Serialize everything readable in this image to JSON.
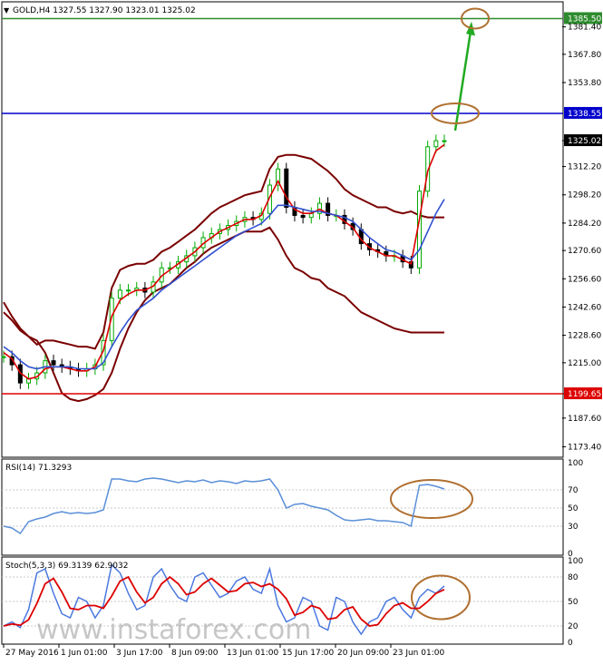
{
  "chart_data": {
    "type": "line",
    "instrument_header": "GOLD,H4  1327.55 1327.90 1323.01 1325.02",
    "watermark": "www.instaforex.com",
    "x_ticks": [
      "27 May 2016",
      "1 Jun 01:00",
      "3 Jun 17:00",
      "8 Jun 09:00",
      "13 Jun 01:00",
      "15 Jun 17:00",
      "20 Jun 09:00",
      "23 Jun 01:00"
    ],
    "price_panel": {
      "ylim": [
        1170.0,
        1392.0
      ],
      "y_ticks": [
        "1381.40",
        "1367.80",
        "1353.80",
        "1325.02",
        "1312.20",
        "1298.20",
        "1284.20",
        "1270.60",
        "1256.60",
        "1242.60",
        "1228.60",
        "1215.00",
        "1199.65",
        "1187.60",
        "1173.40"
      ],
      "levels": [
        {
          "label": "1385.50",
          "value": 1385.5,
          "color": "#2e8b2e"
        },
        {
          "label": "1338.55",
          "value": 1338.55,
          "color": "#0000cc"
        },
        {
          "label": "1199.65",
          "value": 1199.65,
          "color": "#dd0000"
        }
      ],
      "current_price_label": "1325.02",
      "current_price": 1325.02,
      "series": [
        {
          "values": [
            1218,
            1214,
            1205,
            1207,
            1210,
            1216,
            1214,
            1213,
            1212,
            1211,
            1212,
            1214,
            1226,
            1247,
            1251,
            1251,
            1252,
            1250,
            1255,
            1262,
            1262,
            1265,
            1268,
            1272,
            1277,
            1279,
            1281,
            1283,
            1285,
            1287,
            1286,
            1289,
            1303,
            1311,
            1292,
            1288,
            1287,
            1289,
            1294,
            1288,
            1288,
            1284,
            1281,
            1274,
            1271,
            1270,
            1268,
            1268,
            1265,
            1262,
            1300,
            1322,
            1325,
            1325
          ]
        }
      ],
      "moving_averages": [
        {
          "color": "#dd0000",
          "values": [
            1220,
            1217,
            1210,
            1207,
            1208,
            1212,
            1213,
            1213,
            1212,
            1211,
            1211,
            1213,
            1221,
            1238,
            1246,
            1249,
            1251,
            1251,
            1253,
            1258,
            1261,
            1264,
            1267,
            1270,
            1274,
            1277,
            1280,
            1282,
            1284,
            1286,
            1286,
            1288,
            1297,
            1305,
            1297,
            1291,
            1289,
            1289,
            1291,
            1289,
            1288,
            1285,
            1282,
            1276,
            1272,
            1270,
            1268,
            1268,
            1266,
            1264,
            1286,
            1310,
            1320,
            1323
          ]
        },
        {
          "color": "#3050d0",
          "values": [
            1223,
            1220,
            1216,
            1213,
            1212,
            1213,
            1213,
            1213,
            1213,
            1212,
            1212,
            1212,
            1215,
            1223,
            1230,
            1236,
            1241,
            1244,
            1247,
            1251,
            1254,
            1257,
            1260,
            1263,
            1266,
            1269,
            1272,
            1275,
            1278,
            1280,
            1282,
            1284,
            1288,
            1293,
            1293,
            1292,
            1291,
            1290,
            1290,
            1289,
            1288,
            1287,
            1285,
            1281,
            1277,
            1274,
            1271,
            1270,
            1268,
            1266,
            1271,
            1280,
            1289,
            1296
          ]
        }
      ],
      "bollinger_upper": [
        1245,
        1238,
        1232,
        1228,
        1224,
        1226,
        1226,
        1225,
        1224,
        1223,
        1223,
        1222,
        1230,
        1252,
        1261,
        1263,
        1264,
        1264,
        1266,
        1270,
        1272,
        1275,
        1278,
        1281,
        1285,
        1289,
        1292,
        1294,
        1296,
        1298,
        1299,
        1300,
        1311,
        1317,
        1318,
        1318,
        1317,
        1316,
        1313,
        1310,
        1306,
        1301,
        1298,
        1296,
        1294,
        1292,
        1292,
        1290,
        1289,
        1290,
        1288,
        1287,
        1287,
        1287
      ],
      "bollinger_lower": [
        1240,
        1236,
        1231,
        1228,
        1226,
        1220,
        1210,
        1200,
        1197,
        1196,
        1197,
        1199,
        1202,
        1210,
        1222,
        1232,
        1240,
        1246,
        1250,
        1252,
        1254,
        1258,
        1262,
        1265,
        1269,
        1272,
        1274,
        1276,
        1278,
        1280,
        1280,
        1280,
        1282,
        1276,
        1268,
        1262,
        1260,
        1257,
        1256,
        1252,
        1250,
        1248,
        1244,
        1240,
        1238,
        1236,
        1234,
        1232,
        1231,
        1230,
        1230,
        1230,
        1230,
        1230
      ]
    },
    "rsi_panel": {
      "title": "RSI(14) 71.3293",
      "ylim": [
        0,
        100
      ],
      "y_ticks": [
        "100",
        "70",
        "50",
        "30",
        "0"
      ],
      "values": [
        30,
        28,
        22,
        35,
        38,
        40,
        44,
        46,
        44,
        45,
        44,
        45,
        48,
        82,
        82,
        80,
        79,
        82,
        83,
        82,
        80,
        78,
        80,
        79,
        81,
        78,
        80,
        79,
        77,
        80,
        79,
        80,
        82,
        70,
        50,
        54,
        55,
        52,
        50,
        48,
        42,
        37,
        36,
        37,
        38,
        36,
        36,
        35,
        34,
        30,
        75,
        76,
        74,
        71
      ]
    },
    "stoch_panel": {
      "title": "Stoch(5,3,3) 69.3139 62.9032",
      "ylim": [
        0,
        100
      ],
      "y_ticks": [
        "100",
        "80",
        "50",
        "20",
        "0"
      ],
      "main_values": [
        20,
        25,
        18,
        40,
        85,
        90,
        60,
        35,
        30,
        55,
        50,
        30,
        45,
        95,
        85,
        60,
        40,
        45,
        80,
        90,
        70,
        55,
        50,
        80,
        85,
        70,
        55,
        60,
        75,
        80,
        65,
        60,
        90,
        45,
        25,
        30,
        55,
        50,
        20,
        15,
        55,
        50,
        25,
        10,
        25,
        30,
        50,
        55,
        40,
        30,
        55,
        65,
        60,
        69
      ]
    }
  },
  "colors": {
    "background": "#ffffff",
    "grid": "#c8c8c8",
    "candle_up": "#00aa00",
    "candle_down": "#000000",
    "bollinger": "#7a0000",
    "forecast_arrow": "#22aa22",
    "ellipse": "#b07030",
    "rsi_line": "#5a8fd8",
    "stoch_main": "#4a78e0",
    "stoch_signal": "#dd0000"
  }
}
